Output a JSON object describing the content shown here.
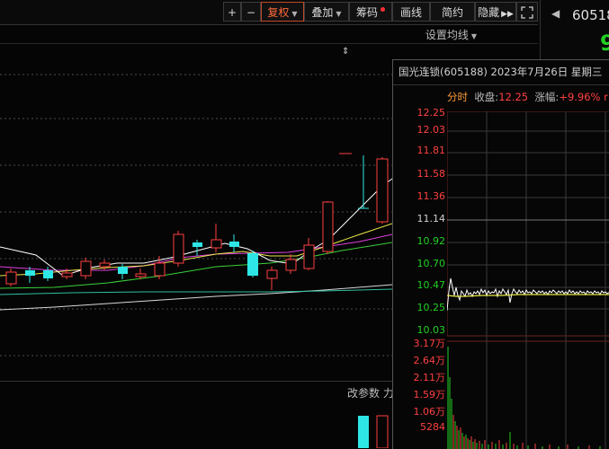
{
  "toolbar": {
    "plus": "+",
    "minus": "−",
    "fuquan": "复权",
    "diejia": "叠加",
    "chouma": "筹码",
    "huaxian": "画线",
    "jianyue": "简约",
    "yincang": "隐藏",
    "expand_icon": "fullscreen-icon"
  },
  "ma_settings_label": "设置均线",
  "quote": {
    "code": "60518",
    "price_partial": "9"
  },
  "popup": {
    "title": "国光连锁(605188) 2023年7月26日 星期三",
    "tab": "分时",
    "close_label": "收盘:",
    "close_value": "12.25",
    "change_label": "涨幅:",
    "change_value": "+9.96%",
    "trailing": "r",
    "price_ticks": [
      "12.25",
      "12.03",
      "11.81",
      "11.58",
      "11.36",
      "11.14",
      "10.92",
      "10.70",
      "10.47",
      "10.25",
      "10.03"
    ],
    "volume_ticks": [
      "3.17万",
      "2.64万",
      "2.11万",
      "1.59万",
      "1.06万",
      "5284"
    ]
  },
  "bottom": {
    "params_label": "改参数",
    "params_trailing": "力"
  },
  "colors": {
    "up": "#ff4040",
    "down": "#2ee6e6",
    "ma5": "#ffffff",
    "ma10": "#e8e84a",
    "ma20": "#e040e0",
    "ma30": "#3ad03a",
    "ma60": "#d8d8d8",
    "intraday_avg": "#e8e84a"
  }
}
